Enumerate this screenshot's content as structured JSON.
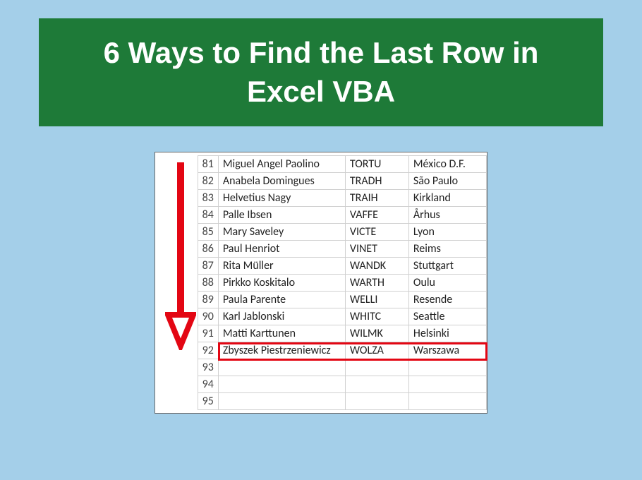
{
  "title": "6 Ways to Find the Last Row in Excel VBA",
  "rows": [
    {
      "num": "81",
      "name": "Miguel Angel Paolino",
      "code": "TORTU",
      "city": "México D.F."
    },
    {
      "num": "82",
      "name": "Anabela Domingues",
      "code": "TRADH",
      "city": "São Paulo"
    },
    {
      "num": "83",
      "name": "Helvetius Nagy",
      "code": "TRAIH",
      "city": "Kirkland"
    },
    {
      "num": "84",
      "name": "Palle Ibsen",
      "code": "VAFFE",
      "city": "Århus"
    },
    {
      "num": "85",
      "name": "Mary Saveley",
      "code": "VICTE",
      "city": "Lyon"
    },
    {
      "num": "86",
      "name": "Paul Henriot",
      "code": "VINET",
      "city": "Reims"
    },
    {
      "num": "87",
      "name": "Rita Müller",
      "code": "WANDK",
      "city": "Stuttgart"
    },
    {
      "num": "88",
      "name": "Pirkko Koskitalo",
      "code": "WARTH",
      "city": "Oulu"
    },
    {
      "num": "89",
      "name": "Paula Parente",
      "code": "WELLI",
      "city": "Resende"
    },
    {
      "num": "90",
      "name": "Karl Jablonski",
      "code": "WHITC",
      "city": "Seattle"
    },
    {
      "num": "91",
      "name": "Matti Karttunen",
      "code": "WILMK",
      "city": "Helsinki"
    },
    {
      "num": "92",
      "name": "Zbyszek Piestrzeniewicz",
      "code": "WOLZA",
      "city": "Warszawa"
    },
    {
      "num": "93",
      "name": "",
      "code": "",
      "city": ""
    },
    {
      "num": "94",
      "name": "",
      "code": "",
      "city": ""
    },
    {
      "num": "95",
      "name": "",
      "code": "",
      "city": ""
    }
  ],
  "highlight_row": "92",
  "arrow_color": "#e30613"
}
